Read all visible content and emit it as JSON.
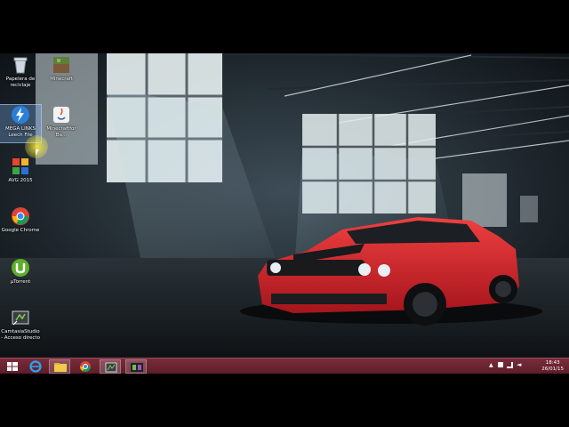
{
  "desktop": {
    "icons": [
      {
        "label": "Papelera de reciclaje",
        "icon": "recycle-bin-icon"
      },
      {
        "label": "Minecraft",
        "icon": "minecraft-icon"
      },
      {
        "label": "MEGA LINKS Leech File",
        "icon": "lightning-app-icon"
      },
      {
        "label": "Minecraftfor Ba...",
        "icon": "java-icon"
      },
      {
        "label": "AVG 2015",
        "icon": "avg-icon"
      },
      {
        "label": "Google Chrome",
        "icon": "chrome-icon"
      },
      {
        "label": "µTorrent",
        "icon": "utorrent-icon"
      },
      {
        "label": "CamtasiaStudio - Acceso directo",
        "icon": "camtasia-icon"
      }
    ]
  },
  "taskbar": {
    "buttons": [
      "start-button",
      "internet-explorer",
      "file-explorer",
      "google-chrome",
      "camtasia",
      "media-app"
    ],
    "clock": {
      "time": "18:43",
      "date": "26/01/15"
    }
  },
  "colors": {
    "taskbar": "#6a2433",
    "car": "#d8262d",
    "wall_light": "#e8f1f2"
  }
}
